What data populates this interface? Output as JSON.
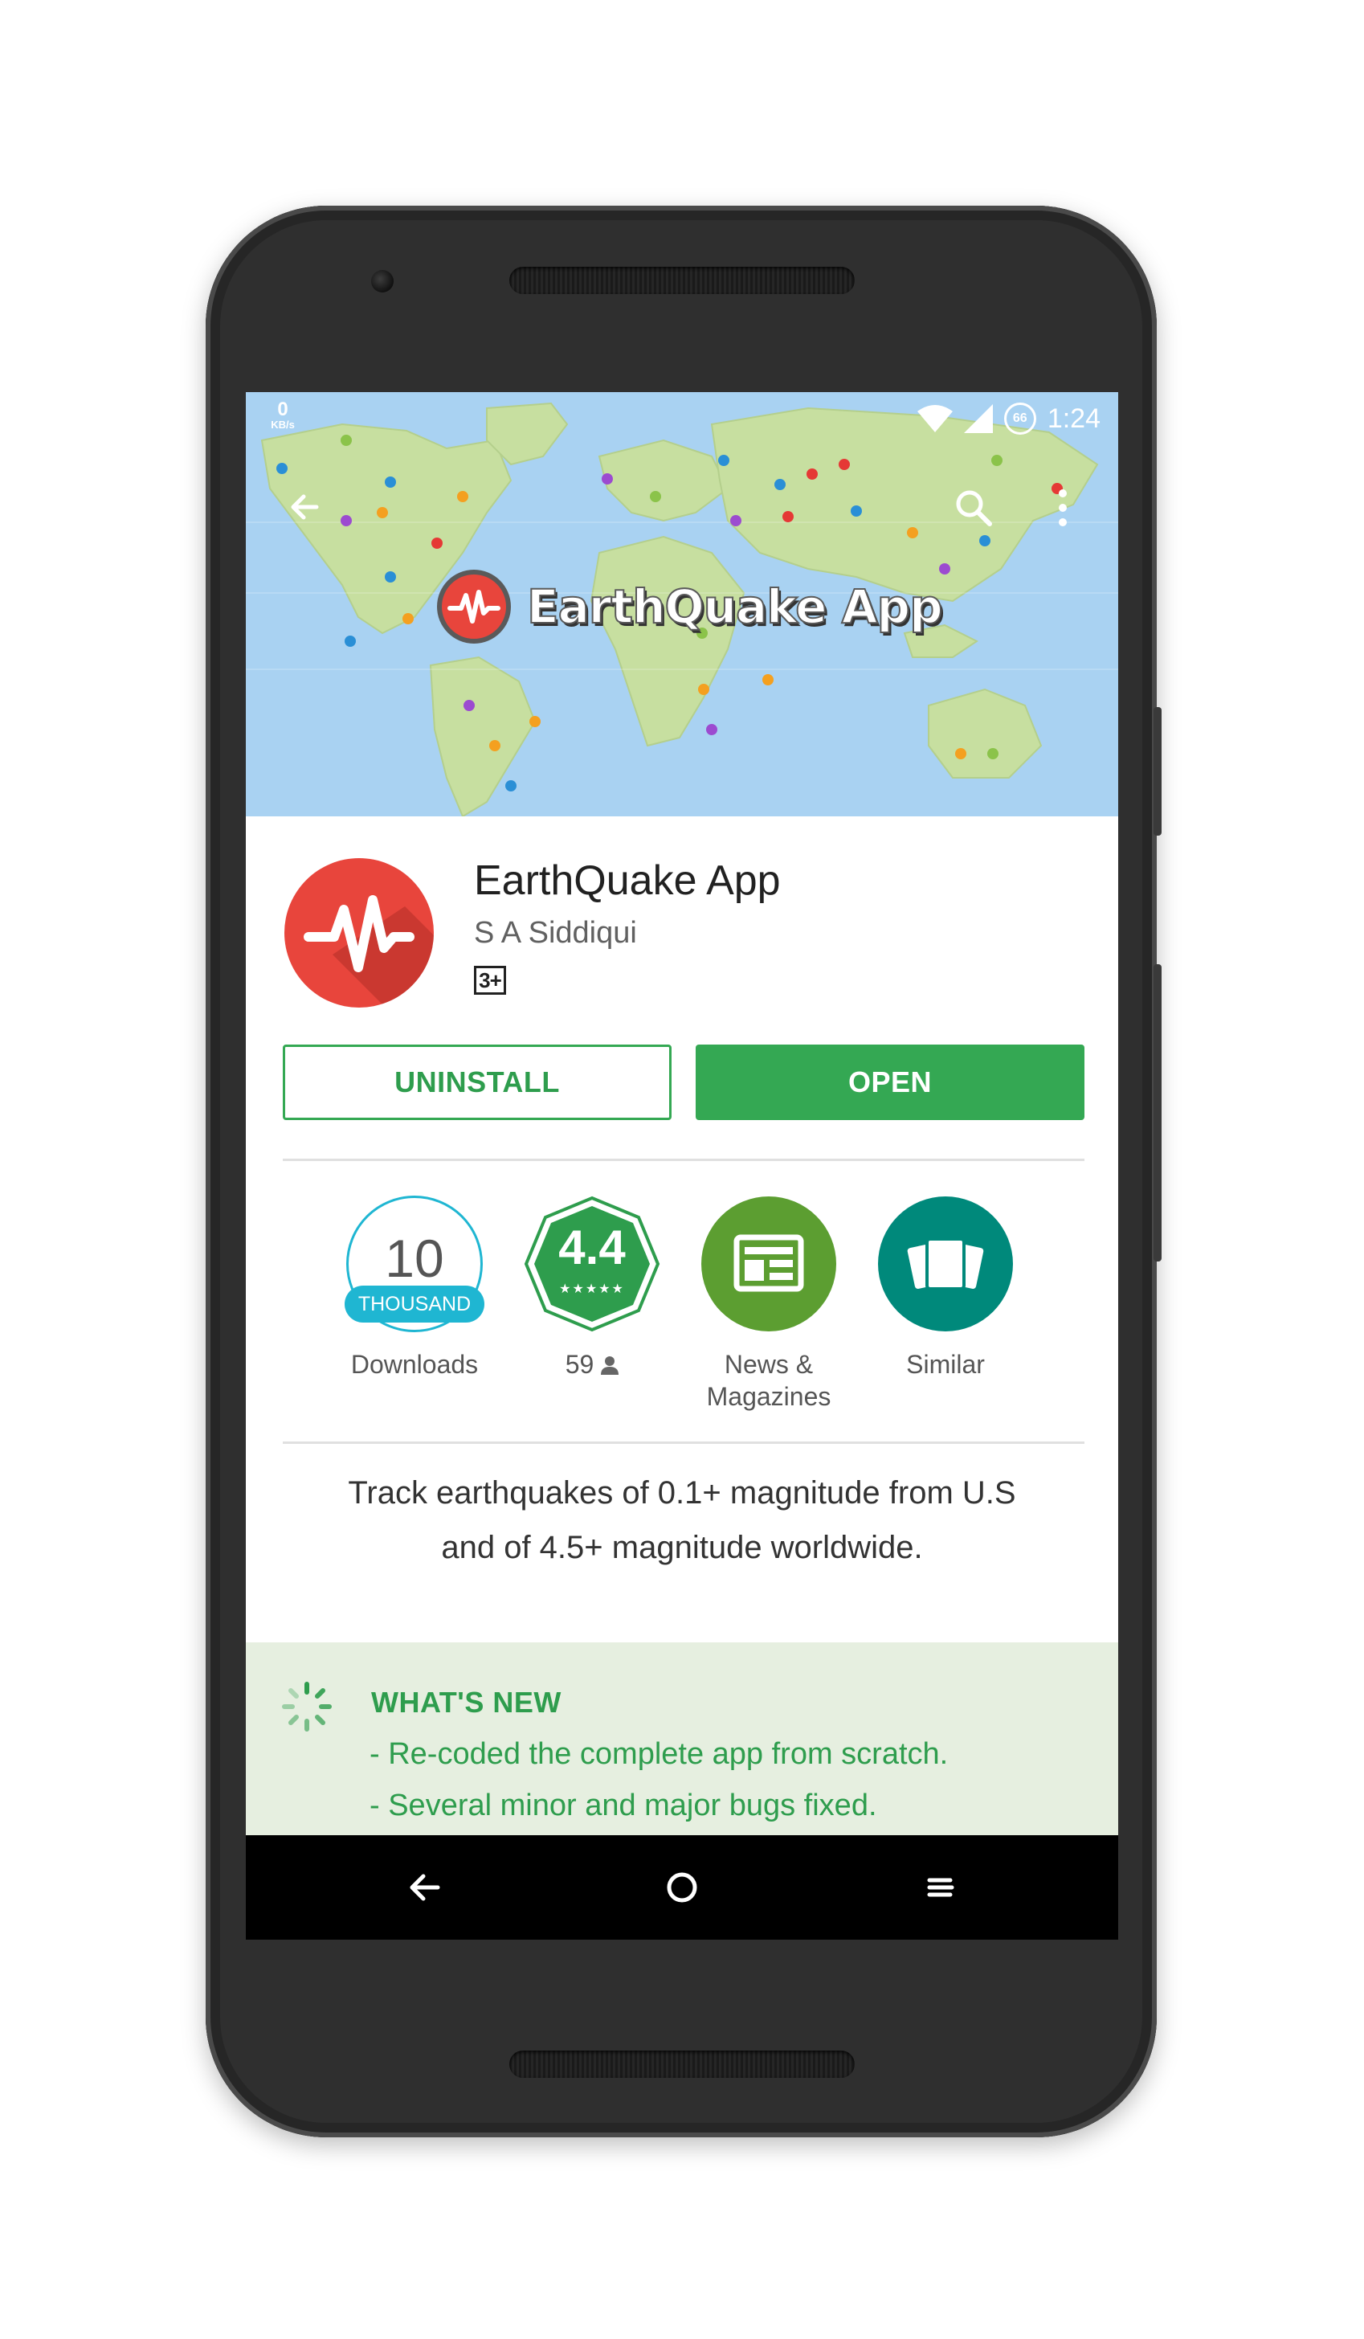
{
  "status_bar": {
    "speed_value": "0",
    "speed_unit": "KB/s",
    "battery_level": "66",
    "time": "1:24"
  },
  "header": {
    "banner_title": "EarthQuake App",
    "map_colors": {
      "water": "#a9d2f2",
      "land": "#c7dfa0"
    }
  },
  "app": {
    "title": "EarthQuake App",
    "developer": "S A Siddiqui",
    "content_rating": "3+",
    "icon_color": "#e8453c"
  },
  "actions": {
    "uninstall_label": "UNINSTALL",
    "open_label": "OPEN",
    "accent_color": "#34a853"
  },
  "badges": {
    "downloads": {
      "number": "10",
      "unit": "THOUSAND",
      "label": "Downloads"
    },
    "rating": {
      "value": "4.4",
      "stars": "★★★★★",
      "count": "59"
    },
    "category": {
      "label_line1": "News &",
      "label_line2": "Magazines",
      "icon": "news-icon"
    },
    "similar": {
      "label": "Similar",
      "icon": "cards-icon"
    }
  },
  "description": {
    "line1": "Track earthquakes of 0.1+ magnitude from U.S",
    "line2": "and of 4.5+ magnitude worldwide."
  },
  "whats_new": {
    "title": "WHAT'S NEW",
    "items": [
      "- Re-coded the complete app from scratch.",
      "- Several minor and major bugs fixed."
    ]
  },
  "nav": {
    "back_icon": "back-icon",
    "home_icon": "home-icon",
    "recents_icon": "recents-icon"
  }
}
